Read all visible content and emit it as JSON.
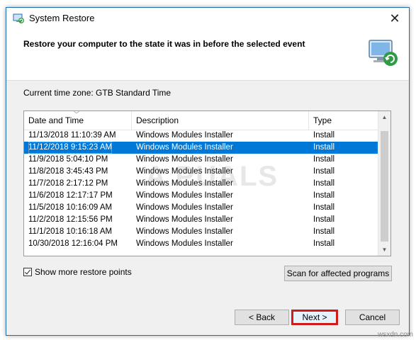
{
  "window": {
    "title": "System Restore",
    "close_glyph": "✕",
    "icon": "system-restore-icon"
  },
  "header": {
    "text": "Restore your computer to the state it was in before the selected event",
    "icon": "restore-monitor-icon"
  },
  "timezone": "Current time zone: GTB Standard Time",
  "list": {
    "columns": [
      "Date and Time",
      "Description",
      "Type"
    ],
    "rows": [
      {
        "date": "11/13/2018 11:10:39 AM",
        "description": "Windows Modules Installer",
        "type": "Install"
      },
      {
        "date": "11/12/2018 9:15:23 AM",
        "description": "Windows Modules Installer",
        "type": "Install"
      },
      {
        "date": "11/9/2018 5:04:10 PM",
        "description": "Windows Modules Installer",
        "type": "Install"
      },
      {
        "date": "11/8/2018 3:45:43 PM",
        "description": "Windows Modules Installer",
        "type": "Install"
      },
      {
        "date": "11/7/2018 2:17:12 PM",
        "description": "Windows Modules Installer",
        "type": "Install"
      },
      {
        "date": "11/6/2018 12:17:17 PM",
        "description": "Windows Modules Installer",
        "type": "Install"
      },
      {
        "date": "11/5/2018 10:16:09 AM",
        "description": "Windows Modules Installer",
        "type": "Install"
      },
      {
        "date": "11/2/2018 12:15:56 PM",
        "description": "Windows Modules Installer",
        "type": "Install"
      },
      {
        "date": "11/1/2018 10:16:18 AM",
        "description": "Windows Modules Installer",
        "type": "Install"
      },
      {
        "date": "10/30/2018 12:16:04 PM",
        "description": "Windows Modules Installer",
        "type": "Install"
      }
    ],
    "selected_index": 1
  },
  "options": {
    "show_more_label": "Show more restore points",
    "show_more_checked": true
  },
  "buttons": {
    "scan": "Scan for affected programs",
    "back": "< Back",
    "next": "Next >",
    "cancel": "Cancel"
  },
  "watermark": "A PUALS",
  "site_label": "wsxdn.com",
  "colors": {
    "selection": "#0078d7",
    "highlight_border": "#d11a1a"
  }
}
